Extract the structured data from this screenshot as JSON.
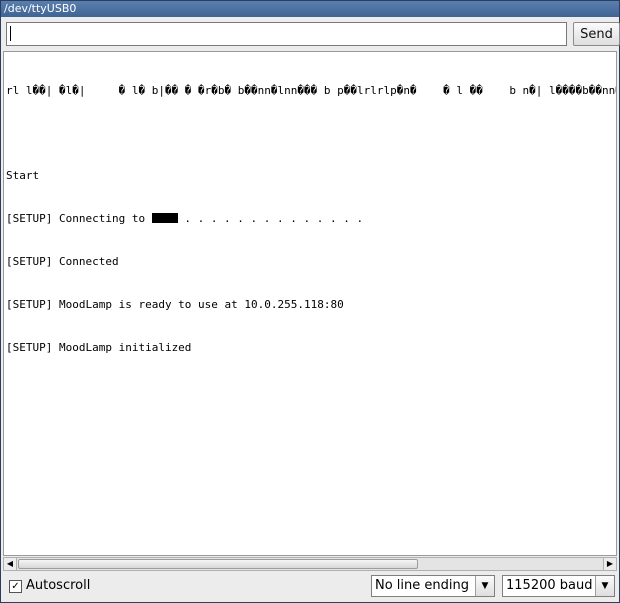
{
  "window": {
    "title": "/dev/ttyUSB0"
  },
  "send": {
    "input_value": "",
    "button_label": "Send"
  },
  "output": {
    "lines": [
      "rl l��| �l�|     � l� b|�� � �r�b� b��nn�lnn��� b p��lrlrlp�n�    � l ��    b n�| l����b��nn� l��",
      "",
      "Start",
      "[SETUP] Connecting to ",
      "[SETUP] Connected",
      "[SETUP] MoodLamp is ready to use at 10.0.255.118:80",
      "[SETUP] MoodLamp initialized"
    ],
    "connecting_dots": " . . . . . . . . . . . . . ."
  },
  "footer": {
    "autoscroll_label": "Autoscroll",
    "autoscroll_checked": true,
    "line_ending": "No line ending",
    "baud": "115200 baud"
  }
}
